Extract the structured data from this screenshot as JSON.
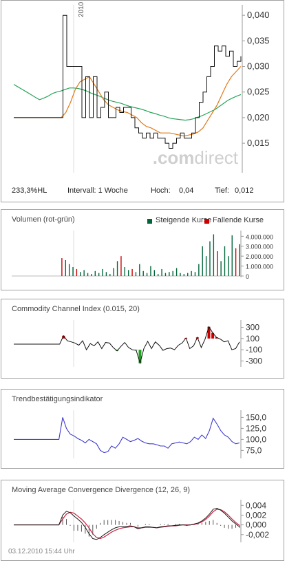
{
  "colors": {
    "up": "#00663a",
    "down": "#cc0000",
    "ma_slow": "#2aa35a",
    "ma_fast": "#e07818",
    "trend": "#3b3bcf",
    "macd": "#1a1a1a",
    "signal": "#cc2244",
    "price": "#111111",
    "watermark": "#cfcfcf"
  },
  "main": {
    "year_label": "2010",
    "watermark_a": ".com",
    "watermark_b": "direct",
    "stats": {
      "perf": "233,3%HL",
      "interval": "Intervall: 1 Woche",
      "high_label": "Hoch:",
      "high": "0,04",
      "low_label": "Tief:",
      "low": "0,012"
    }
  },
  "volume_panel": {
    "title": "Volumen (rot-grün)",
    "legend_up": "Steigende Kurse",
    "legend_down": "Fallende Kurse"
  },
  "cci_panel": {
    "title": "Commodity Channel Index (0.015, 20)"
  },
  "trend_panel": {
    "title": "Trendbestätigungsindikator"
  },
  "macd_panel": {
    "title": "Moving Average Convergence Divergence (12, 26, 9)"
  },
  "timestamp": "03.12.2010 15:44 Uhr",
  "chart_data": [
    {
      "type": "line",
      "name": "price",
      "yticks": [
        "0,040",
        "0,035",
        "0,030",
        "0,025",
        "0,020",
        "0,015"
      ],
      "ylim": [
        0.0095,
        0.0415
      ],
      "price": [
        0.02,
        0.02,
        0.02,
        0.02,
        0.02,
        0.02,
        0.02,
        0.02,
        0.02,
        0.02,
        0.02,
        0.02,
        0.02,
        0.04,
        0.03,
        0.03,
        0.03,
        0.03,
        0.02,
        0.028,
        0.02,
        0.028,
        0.02,
        0.022,
        0.025,
        0.02,
        0.02,
        0.022,
        0.021,
        0.022,
        0.022,
        0.02,
        0.018,
        0.017,
        0.016,
        0.017,
        0.016,
        0.017,
        0.016,
        0.016,
        0.015,
        0.014,
        0.015,
        0.016,
        0.017,
        0.016,
        0.016,
        0.017,
        0.02,
        0.023,
        0.025,
        0.028,
        0.03,
        0.034,
        0.033,
        0.034,
        0.032,
        0.033,
        0.03,
        0.031,
        0.032
      ],
      "ma_slow": [
        0.0265,
        0.026,
        0.0255,
        0.025,
        0.0245,
        0.024,
        0.0235,
        0.0238,
        0.0242,
        0.0247,
        0.025,
        0.0252,
        0.0255,
        0.0258,
        0.0258,
        0.0257,
        0.0255,
        0.0252,
        0.0248,
        0.0245,
        0.0242,
        0.0238,
        0.0235,
        0.0232,
        0.023,
        0.0228,
        0.0225,
        0.0222,
        0.022,
        0.0218,
        0.0216,
        0.0213,
        0.021,
        0.0208,
        0.0205,
        0.0203,
        0.02,
        0.0198,
        0.0197,
        0.0196,
        0.0195,
        0.0196,
        0.0198,
        0.0201,
        0.0204,
        0.0208,
        0.0212,
        0.0216,
        0.0222,
        0.0228,
        0.0234,
        0.0238,
        0.0242,
        0.0245
      ],
      "ma_fast": [
        0.02,
        0.02,
        0.02,
        0.02,
        0.02,
        0.02,
        0.02,
        0.02,
        0.02,
        0.02,
        0.02,
        0.021,
        0.023,
        0.0255,
        0.027,
        0.0275,
        0.028,
        0.0265,
        0.025,
        0.0235,
        0.0225,
        0.022,
        0.0215,
        0.0212,
        0.021,
        0.0205,
        0.02,
        0.019,
        0.0183,
        0.018,
        0.0175,
        0.017,
        0.017,
        0.017,
        0.0168,
        0.0166,
        0.0164,
        0.0166,
        0.0168,
        0.0172,
        0.018,
        0.0195,
        0.021,
        0.0225,
        0.0245,
        0.0265,
        0.028,
        0.029,
        0.03
      ]
    },
    {
      "type": "bar",
      "name": "volume",
      "yticks": [
        "4.000.000",
        "3.000.000",
        "2.000.000",
        "1.000.000",
        "0"
      ],
      "ylim": [
        0,
        4300000
      ],
      "values": [
        0,
        0,
        0,
        0,
        0,
        0,
        0,
        0,
        0,
        0,
        0,
        0,
        0,
        1800000,
        1600000,
        1200000,
        900000,
        700000,
        400000,
        600000,
        300000,
        200000,
        500000,
        300000,
        700000,
        400000,
        200000,
        800000,
        1500000,
        2000000,
        900000,
        600000,
        700000,
        400000,
        1200000,
        500000,
        300000,
        1000000,
        600000,
        200000,
        700000,
        300000,
        400000,
        500000,
        800000,
        300000,
        200000,
        300000,
        500000,
        400000,
        1200000,
        3000000,
        2000000,
        3500000,
        4200000,
        2500000,
        1500000,
        3000000,
        2000000,
        4100000,
        2800000,
        3200000
      ],
      "down": [
        false,
        false,
        false,
        false,
        false,
        false,
        false,
        false,
        false,
        false,
        false,
        false,
        false,
        true,
        false,
        false,
        false,
        true,
        false,
        false,
        false,
        false,
        false,
        false,
        false,
        false,
        false,
        false,
        false,
        true,
        false,
        false,
        true,
        false,
        false,
        false,
        false,
        false,
        false,
        false,
        false,
        false,
        false,
        false,
        false,
        false,
        false,
        false,
        false,
        false,
        false,
        false,
        false,
        false,
        false,
        true,
        false,
        false,
        false,
        false,
        true,
        false
      ]
    },
    {
      "type": "line",
      "name": "cci",
      "yticks": [
        "300",
        "100",
        "-100",
        "-300"
      ],
      "ylim": [
        -380,
        380
      ],
      "values": [
        0,
        0,
        0,
        0,
        0,
        0,
        0,
        0,
        0,
        0,
        0,
        0,
        0,
        150,
        60,
        40,
        20,
        -20,
        60,
        -100,
        10,
        -30,
        40,
        -80,
        30,
        20,
        -60,
        -120,
        -40,
        30,
        -60,
        -100,
        -110,
        -340,
        -80,
        50,
        -80,
        40,
        -20,
        -110,
        -80,
        -70,
        -100,
        -20,
        20,
        110,
        -80,
        -30,
        120,
        -60,
        90,
        310,
        200,
        120,
        90,
        40,
        60,
        -100,
        -80,
        40
      ]
    },
    {
      "type": "line",
      "name": "trend",
      "yticks": [
        "150,0",
        "125,0",
        "100,0",
        "75,0"
      ],
      "ylim": [
        60,
        160
      ],
      "values": [
        100,
        100,
        100,
        100,
        100,
        100,
        100,
        100,
        100,
        100,
        100,
        100,
        100,
        150,
        125,
        112,
        108,
        102,
        98,
        92,
        100,
        95,
        90,
        75,
        70,
        72,
        85,
        80,
        90,
        105,
        100,
        95,
        98,
        102,
        96,
        92,
        90,
        90,
        88,
        85,
        85,
        80,
        90,
        92,
        94,
        92,
        90,
        95,
        105,
        100,
        110,
        102,
        120,
        148,
        135,
        120,
        110,
        105,
        95,
        90,
        92
      ]
    },
    {
      "type": "line",
      "name": "macd",
      "yticks": [
        "0,004",
        "0,002",
        "0,000",
        "-0,002"
      ],
      "ylim": [
        -0.0033,
        0.0046
      ],
      "macd": [
        0,
        0,
        0,
        0,
        0,
        0,
        0,
        0,
        0,
        0,
        0,
        0,
        0,
        0.002,
        0.0028,
        0.0025,
        0.0018,
        0.0012,
        0.0005,
        -0.0005,
        -0.0018,
        -0.0028,
        -0.003,
        -0.0026,
        -0.002,
        -0.0015,
        -0.001,
        -0.0006,
        -0.0004,
        -0.0003,
        -0.0003,
        -0.0002,
        -0.0004,
        -0.0008,
        -0.0006,
        -0.0004,
        -0.0004,
        -0.0005,
        -0.0006,
        -0.0004,
        -0.0003,
        -0.0002,
        -0.0002,
        -0.0001,
        0,
        0,
        -0.0001,
        0,
        0.0002,
        0.0004,
        0.0008,
        0.0014,
        0.0022,
        0.0032,
        0.0034,
        0.003,
        0.0024,
        0.0016,
        0.0008,
        0.0002,
        -0.0004
      ],
      "signal": [
        0,
        0,
        0,
        0,
        0,
        0,
        0,
        0,
        0,
        0,
        0,
        0,
        0,
        0.0012,
        0.0022,
        0.0026,
        0.0024,
        0.0018,
        0.0012,
        0.0004,
        -0.0006,
        -0.0018,
        -0.0026,
        -0.0028,
        -0.0025,
        -0.002,
        -0.0015,
        -0.0011,
        -0.0008,
        -0.0006,
        -0.0005,
        -0.0004,
        -0.0004,
        -0.0006,
        -0.0006,
        -0.0005,
        -0.0005,
        -0.0005,
        -0.0006,
        -0.0005,
        -0.0004,
        -0.0003,
        -0.0002,
        -0.0002,
        -0.0001,
        0,
        0,
        0,
        0.0001,
        0.0003,
        0.0006,
        0.0011,
        0.0018,
        0.0027,
        0.0032,
        0.0031,
        0.0027,
        0.002,
        0.0012,
        0.0005,
        -0.0001
      ]
    }
  ]
}
